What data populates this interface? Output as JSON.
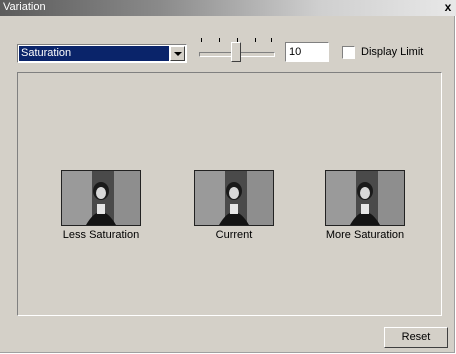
{
  "window": {
    "title": "Variation"
  },
  "toolbar": {
    "mode_select": {
      "value": "Saturation"
    },
    "slider": {
      "value_fraction": 0.5
    },
    "amount_input": {
      "value": "10"
    },
    "display_limit": {
      "label": "Display Limit",
      "checked": false
    }
  },
  "variants": [
    {
      "label": "Less Saturation"
    },
    {
      "label": "Current"
    },
    {
      "label": "More Saturation"
    }
  ],
  "buttons": {
    "reset_label": "Reset"
  }
}
